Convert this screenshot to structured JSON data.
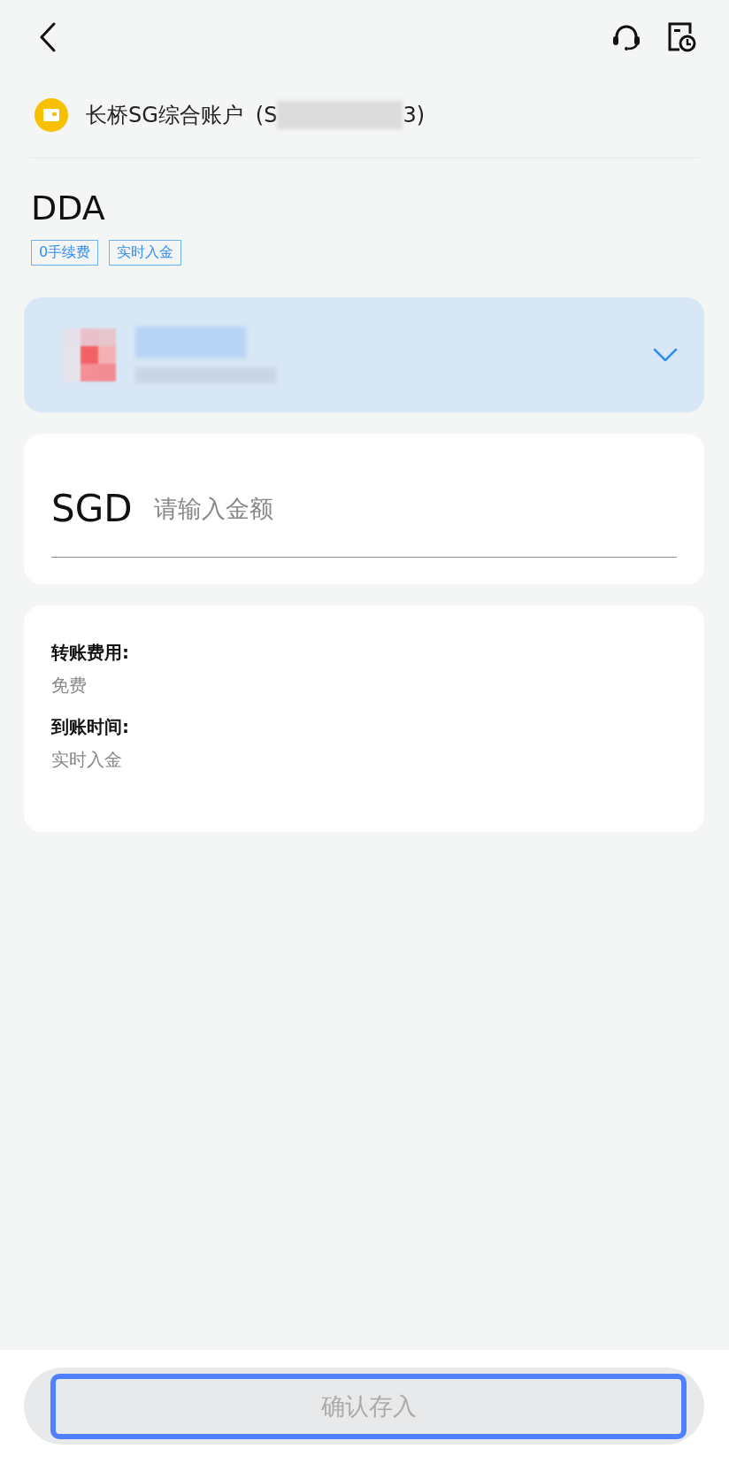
{
  "account": {
    "name": "长桥SG综合账户",
    "number_start": "(S",
    "number_end": "3)"
  },
  "method": {
    "title": "DDA",
    "tags": [
      "0手续费",
      "实时入金"
    ]
  },
  "bank_selector": {
    "expanded": false
  },
  "amount": {
    "currency": "SGD",
    "placeholder": "请输入金额"
  },
  "info": [
    {
      "label": "转账费用:",
      "value": "免费"
    },
    {
      "label": "到账时间:",
      "value": "实时入金"
    }
  ],
  "confirm_button": {
    "label": "确认存入",
    "disabled": true,
    "focused": true
  }
}
